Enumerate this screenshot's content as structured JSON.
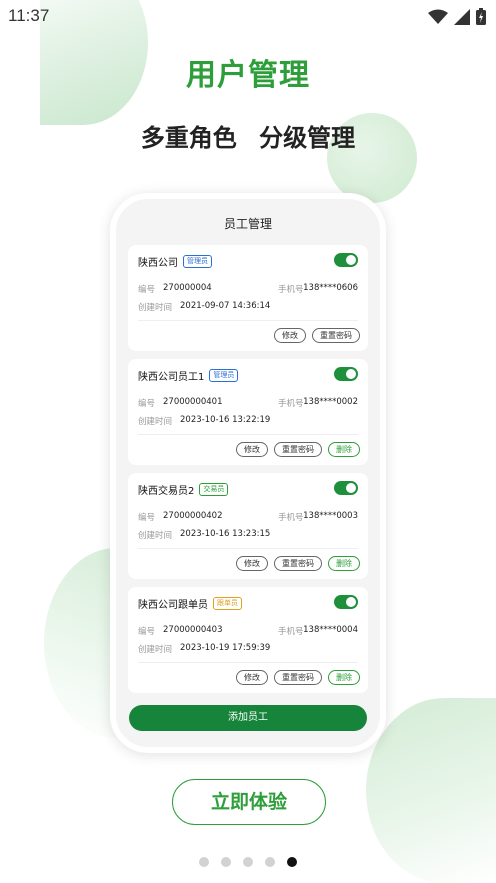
{
  "status_bar": {
    "time": "11:37"
  },
  "hero": {
    "title": "用户管理",
    "subtitle": "多重角色 分级管理"
  },
  "phone": {
    "title": "员工管理",
    "labels": {
      "id": "编号",
      "phone": "手机号",
      "created": "创建时间"
    },
    "actions": {
      "edit": "修改",
      "reset": "重置密码",
      "delete": "删除"
    },
    "cards": [
      {
        "name": "陕西公司",
        "role": "管理员",
        "role_color": "#2a6fd6",
        "id": "270000004",
        "phone": "138****0606",
        "created": "2021-09-07 14:36:14",
        "enabled": true,
        "deletable": false
      },
      {
        "name": "陕西公司员工1",
        "role": "管理员",
        "role_color": "#2a6fd6",
        "id": "27000000401",
        "phone": "138****0002",
        "created": "2023-10-16 13:22:19",
        "enabled": true,
        "deletable": true
      },
      {
        "name": "陕西交易员2",
        "role": "交易员",
        "role_color": "#2e9e3a",
        "id": "27000000402",
        "phone": "138****0003",
        "created": "2023-10-16 13:23:15",
        "enabled": true,
        "deletable": true
      },
      {
        "name": "陕西公司跟单员",
        "role": "跟单员",
        "role_color": "#e0a020",
        "id": "27000000403",
        "phone": "138****0004",
        "created": "2023-10-19 17:59:39",
        "enabled": true,
        "deletable": true
      }
    ],
    "add_button": "添加员工"
  },
  "cta": {
    "label": "立即体验"
  },
  "pager": {
    "count": 5,
    "active": 4
  },
  "colors": {
    "brand_green": "#2e9e3a",
    "button_green": "#16843a"
  }
}
